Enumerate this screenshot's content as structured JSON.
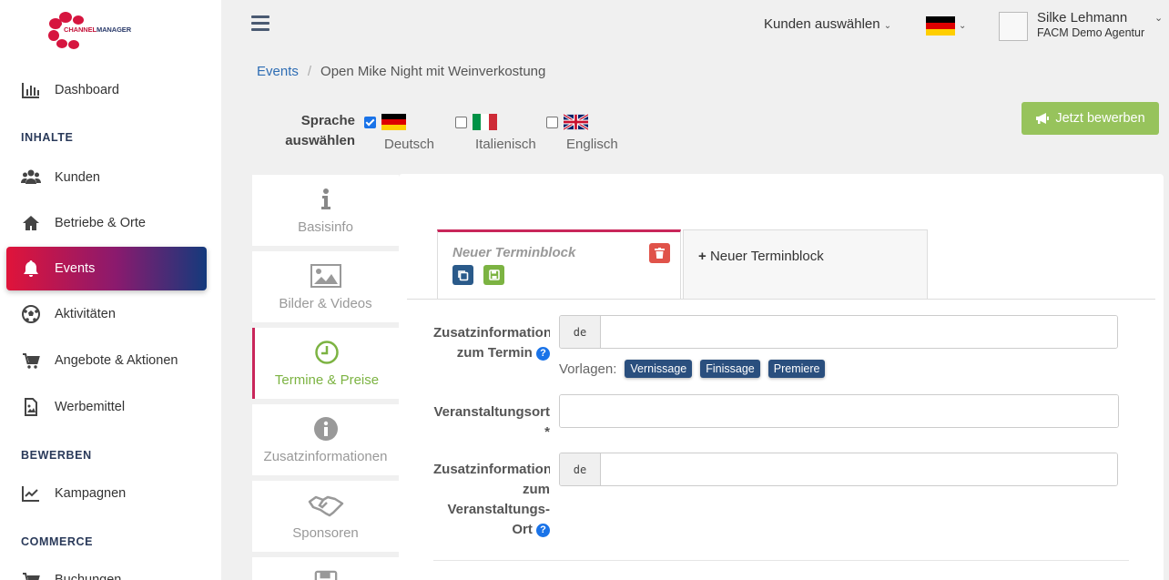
{
  "brand": {
    "name_part1": "CHANNEL",
    "name_part2": "MANAGER",
    "color": "#c4143b"
  },
  "sidebar": {
    "items": [
      {
        "label": "Dashboard",
        "icon": "bar-chart-icon"
      },
      {
        "label": "Kunden",
        "icon": "users-icon"
      },
      {
        "label": "Betriebe & Orte",
        "icon": "home-icon"
      },
      {
        "label": "Events",
        "icon": "bell-icon",
        "active": true
      },
      {
        "label": "Aktivitäten",
        "icon": "soccer-ball-icon"
      },
      {
        "label": "Angebote & Aktionen",
        "icon": "shopping-cart-icon"
      },
      {
        "label": "Werbemittel",
        "icon": "image-file-icon"
      },
      {
        "label": "Kampagnen",
        "icon": "line-chart-icon"
      },
      {
        "label": "Buchungen",
        "icon": "cart-icon"
      }
    ],
    "sections": {
      "content": "INHALTE",
      "promote": "BEWERBEN",
      "commerce": "COMMERCE"
    },
    "active_gradient": [
      "#e0143a",
      "#8a1a6e",
      "#143a7c"
    ]
  },
  "topbar": {
    "customer_select": "Kunden auswählen",
    "language_flag": "flag-de-icon",
    "user": {
      "name": "Silke Lehmann",
      "agency": "FACM Demo Agentur"
    }
  },
  "breadcrumb": {
    "parent": "Events",
    "current": "Open Mike Night mit Weinverkostung"
  },
  "language_select": {
    "label_line1": "Sprache",
    "label_line2": "auswählen",
    "options": [
      {
        "name": "Deutsch",
        "checked": true,
        "flag": "flag-de-icon"
      },
      {
        "name": "Italienisch",
        "checked": false,
        "flag": "flag-it-icon"
      },
      {
        "name": "Englisch",
        "checked": false,
        "flag": "flag-uk-icon"
      }
    ]
  },
  "promote_button": {
    "label": "Jetzt bewerben",
    "icon": "megaphone-icon",
    "color": "#97c35c"
  },
  "vertical_tabs": [
    {
      "label": "Basisinfo",
      "icon": "info-icon"
    },
    {
      "label": "Bilder & Videos",
      "icon": "image-icon"
    },
    {
      "label": "Termine & Preise",
      "icon": "clock-icon",
      "active": true
    },
    {
      "label": "Zusatzinformationen",
      "icon": "info-circle-icon"
    },
    {
      "label": "Sponsoren",
      "icon": "handshake-icon"
    }
  ],
  "term_blocks": {
    "tabs": [
      {
        "title": "Neuer Terminblock"
      },
      {
        "title": "Neuer Terminblock",
        "prefix": "+"
      }
    ]
  },
  "form": {
    "extra_info": {
      "label_line1": "Zusatzinformation",
      "label_line2": "zum Termin",
      "lang": "de",
      "value": ""
    },
    "templates": {
      "label": "Vorlagen:",
      "items": [
        "Vernissage",
        "Finissage",
        "Premiere"
      ]
    },
    "venue": {
      "label": "Veranstaltungsort",
      "required_marker": "*",
      "value": ""
    },
    "venue_info": {
      "label_line1": "Zusatzinformation",
      "label_line2": "zum",
      "label_line3": "Veranstaltungs-",
      "label_line4": "Ort",
      "lang": "de",
      "value": ""
    }
  }
}
